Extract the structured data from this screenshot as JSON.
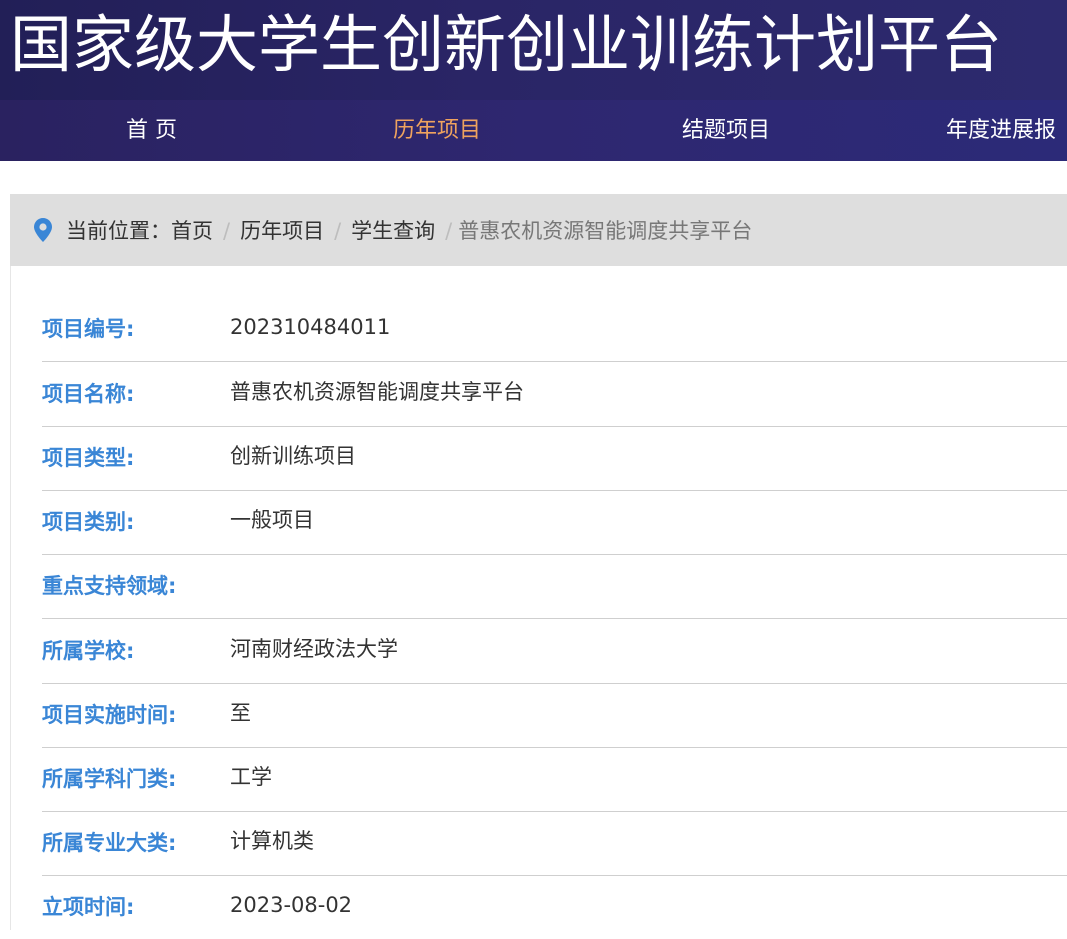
{
  "site": {
    "title": "国家级大学生创新创业训练计划平台"
  },
  "nav": {
    "items": [
      {
        "label": "首 页",
        "active": false
      },
      {
        "label": "历年项目",
        "active": true
      },
      {
        "label": "结题项目",
        "active": false
      },
      {
        "label": "年度进展报",
        "active": false
      }
    ]
  },
  "breadcrumb": {
    "prefix": "当前位置：",
    "items": [
      "首页",
      "历年项目",
      "学生查询",
      "普惠农机资源智能调度共享平台"
    ],
    "separator": "/",
    "icon": "location-pin-icon"
  },
  "details": [
    {
      "label": "项目编号:",
      "value": "202310484011"
    },
    {
      "label": "项目名称:",
      "value": "普惠农机资源智能调度共享平台"
    },
    {
      "label": "项目类型:",
      "value": "创新训练项目"
    },
    {
      "label": "项目类别:",
      "value": "一般项目"
    },
    {
      "label": "重点支持领域:",
      "value": ""
    },
    {
      "label": "所属学校:",
      "value": "河南财经政法大学"
    },
    {
      "label": "项目实施时间:",
      "value": "至"
    },
    {
      "label": "所属学科门类:",
      "value": "工学"
    },
    {
      "label": "所属专业大类:",
      "value": "计算机类"
    },
    {
      "label": "立项时间:",
      "value": "2023-08-02"
    }
  ],
  "colors": {
    "header_bg": "#221f57",
    "nav_active": "#f0a35e",
    "label_blue": "#3a86d6",
    "breadcrumb_bg": "#dedede"
  }
}
